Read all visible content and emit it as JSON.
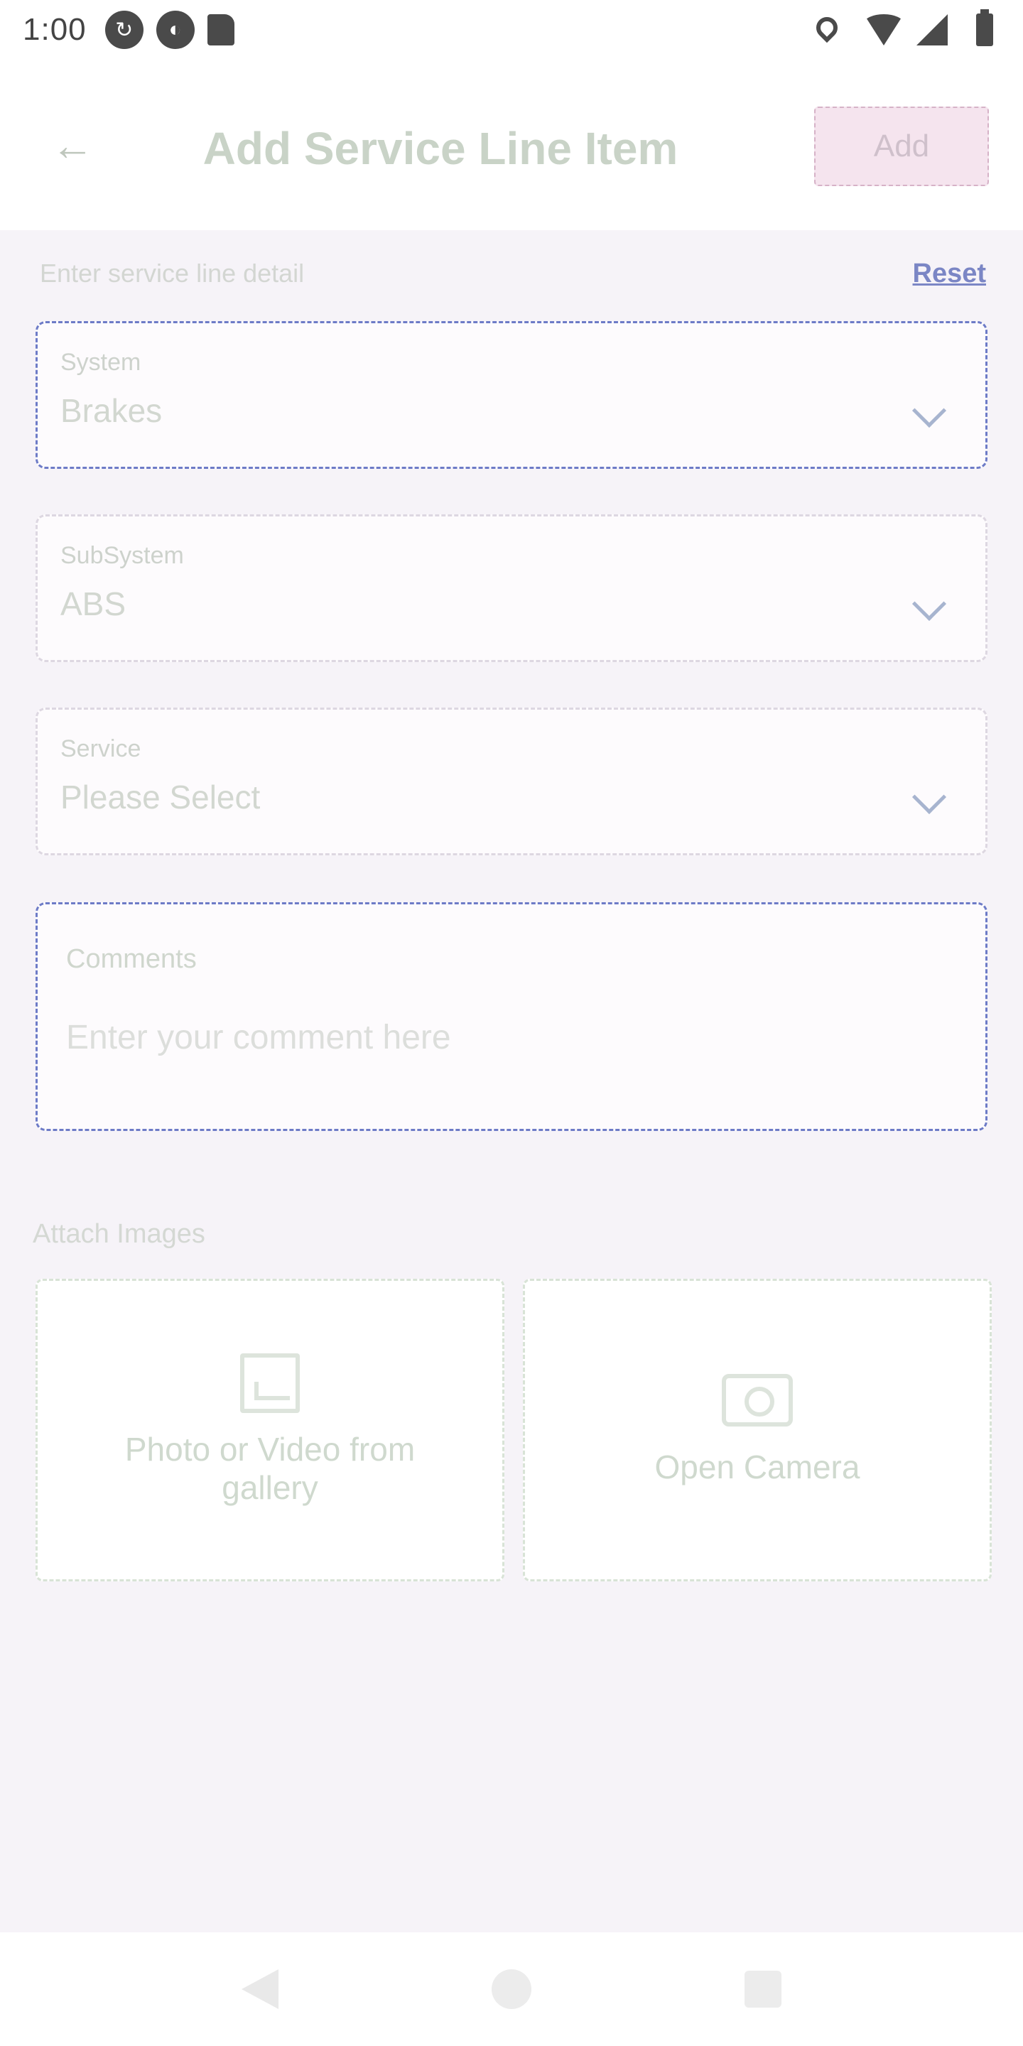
{
  "status_bar": {
    "time": "1:00"
  },
  "header": {
    "title": "Add Service Line Item",
    "add_label": "Add"
  },
  "form": {
    "section_label": "Enter service line detail",
    "reset_label": "Reset",
    "system": {
      "label": "System",
      "value": "Brakes"
    },
    "subsystem": {
      "label": "SubSystem",
      "value": "ABS"
    },
    "service": {
      "label": "Service",
      "value": "Please Select"
    },
    "comments": {
      "label": "Comments",
      "placeholder": "Enter your comment here"
    }
  },
  "attachments": {
    "label": "Attach Images",
    "gallery_label": "Photo or Video from gallery",
    "camera_label": "Open Camera"
  }
}
